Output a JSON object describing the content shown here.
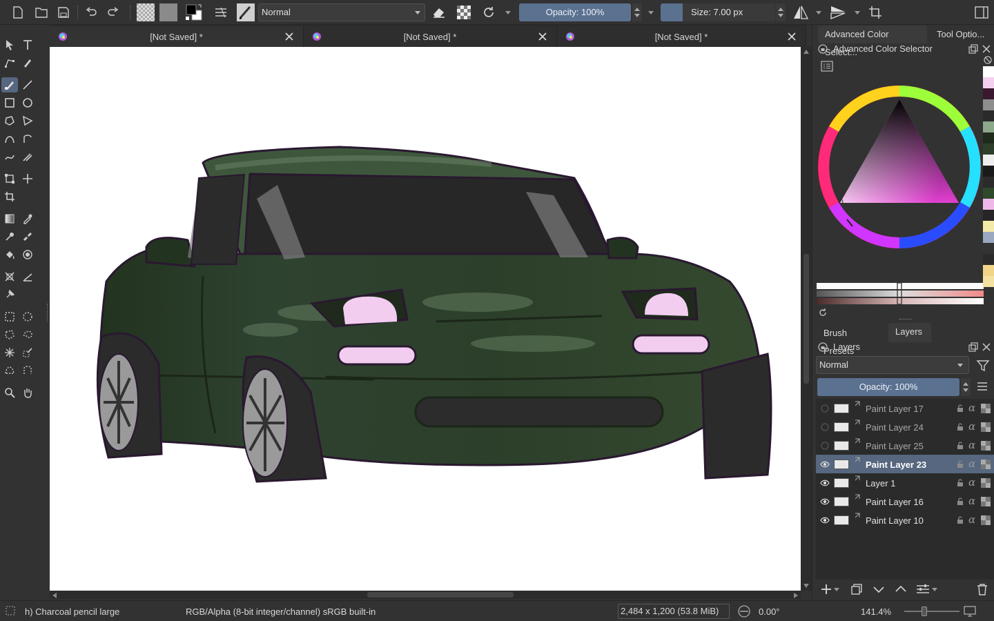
{
  "toolbar": {
    "blend_mode": "Normal",
    "opacity_label": "Opacity: 100%",
    "size_label": "Size: 7.00 px"
  },
  "tabs": [
    {
      "title": "[Not Saved]  *"
    },
    {
      "title": "[Not Saved]  *"
    },
    {
      "title": "[Not Saved]  *"
    }
  ],
  "docker": {
    "top_tabs": [
      "Advanced Color Select...",
      "Tool Optio..."
    ],
    "color_selector_title": "Advanced Color Selector",
    "bottom_tabs": [
      "Brush Presets",
      "Layers"
    ],
    "layers_title": "Layers",
    "layers_blend": "Normal",
    "layers_opacity": "Opacity:  100%",
    "palette": [
      "#ffffff",
      "#f4d0ef",
      "#3a1830",
      "#8e8e8e",
      "#2a2a2a",
      "#8ca88a",
      "#1e2a1c",
      "#2d3f2a",
      "#eeeeee",
      "#1a1a1a",
      "#2b2b2b",
      "#2e4a2a",
      "#f0b8ea",
      "#262626",
      "#f4eaa8",
      "#9aa8c0",
      "#333333",
      "#2a2a2a",
      "#f0d488",
      "#f4e2a0"
    ],
    "layers": [
      {
        "name": "Paint Layer 17",
        "visible": false,
        "selected": false
      },
      {
        "name": "Paint Layer 24",
        "visible": false,
        "selected": false
      },
      {
        "name": "Paint Layer 25",
        "visible": false,
        "selected": false
      },
      {
        "name": "Paint Layer 23",
        "visible": true,
        "selected": true
      },
      {
        "name": "Layer 1",
        "visible": true,
        "selected": false
      },
      {
        "name": "Paint Layer 16",
        "visible": true,
        "selected": false
      },
      {
        "name": "Paint Layer 10",
        "visible": true,
        "selected": false
      }
    ]
  },
  "status": {
    "brush": "h) Charcoal pencil large",
    "color_model": "RGB/Alpha (8-bit integer/channel)  sRGB built-in",
    "dimensions": "2,484 x 1,200 (53.8 MiB)",
    "rotation": "0.00°",
    "zoom": "141.4%"
  },
  "colors": {
    "accent": "#5b7190",
    "car_body": "#2c3f2a",
    "outline": "#2a1830"
  }
}
